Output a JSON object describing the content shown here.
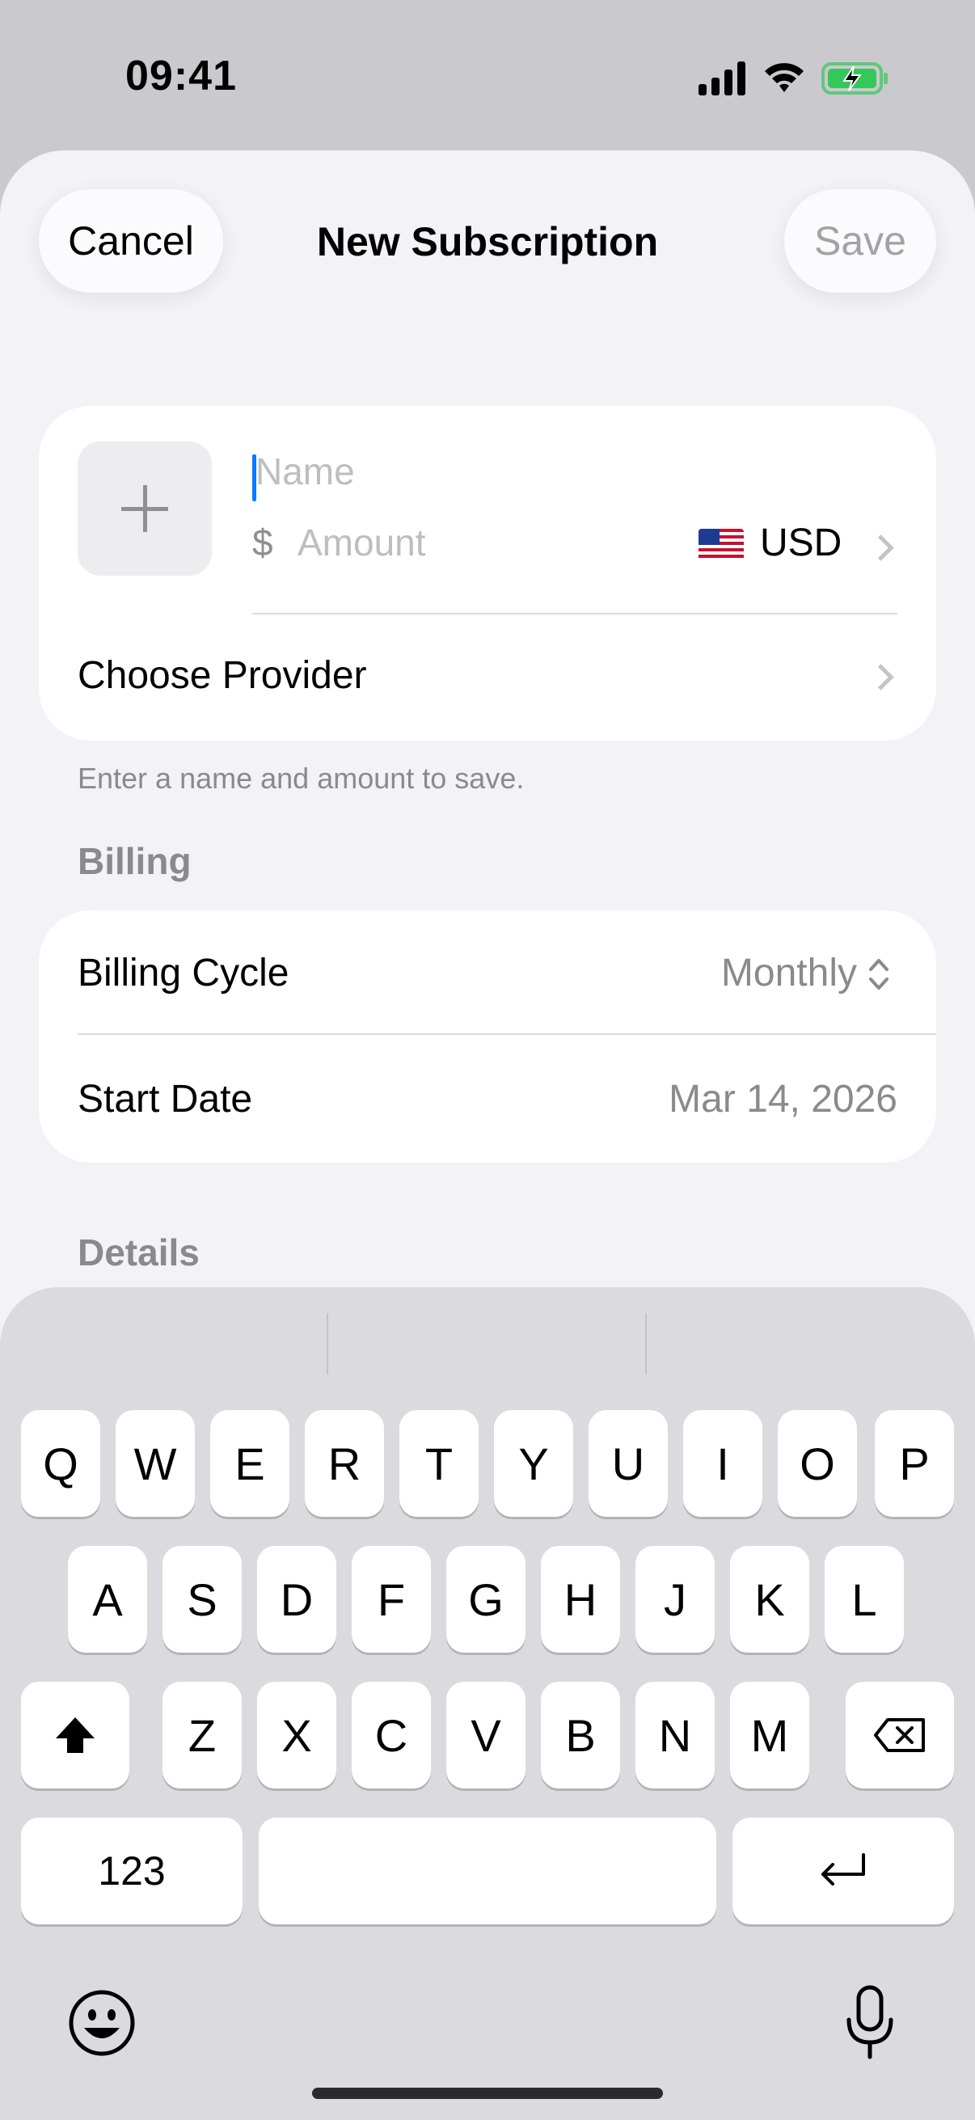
{
  "status_bar": {
    "time": "09:41"
  },
  "sheet": {
    "title": "New Subscription",
    "cancel_label": "Cancel",
    "save_label": "Save"
  },
  "form": {
    "name_placeholder": "Name",
    "currency_symbol": "$",
    "amount_placeholder": "Amount",
    "currency_code": "USD",
    "currency_flag": "us-flag",
    "provider_label": "Choose Provider",
    "helper_text": "Enter a name and amount to save."
  },
  "billing": {
    "section_title": "Billing",
    "cycle_label": "Billing Cycle",
    "cycle_value": "Monthly",
    "start_label": "Start Date",
    "start_value": "Mar 14, 2026"
  },
  "details": {
    "section_title": "Details"
  },
  "keyboard": {
    "row1": [
      "Q",
      "W",
      "E",
      "R",
      "T",
      "Y",
      "U",
      "I",
      "O",
      "P"
    ],
    "row2": [
      "A",
      "S",
      "D",
      "F",
      "G",
      "H",
      "J",
      "K",
      "L"
    ],
    "row3": [
      "Z",
      "X",
      "C",
      "V",
      "B",
      "N",
      "M"
    ],
    "numbers_label": "123",
    "icons": [
      "shift-icon",
      "delete-icon",
      "return-icon",
      "emoji-icon",
      "microphone-icon"
    ]
  },
  "colors": {
    "accent": "#0a7aff",
    "background": "#f2f2f7",
    "secondary_text": "#8a8a8e"
  }
}
